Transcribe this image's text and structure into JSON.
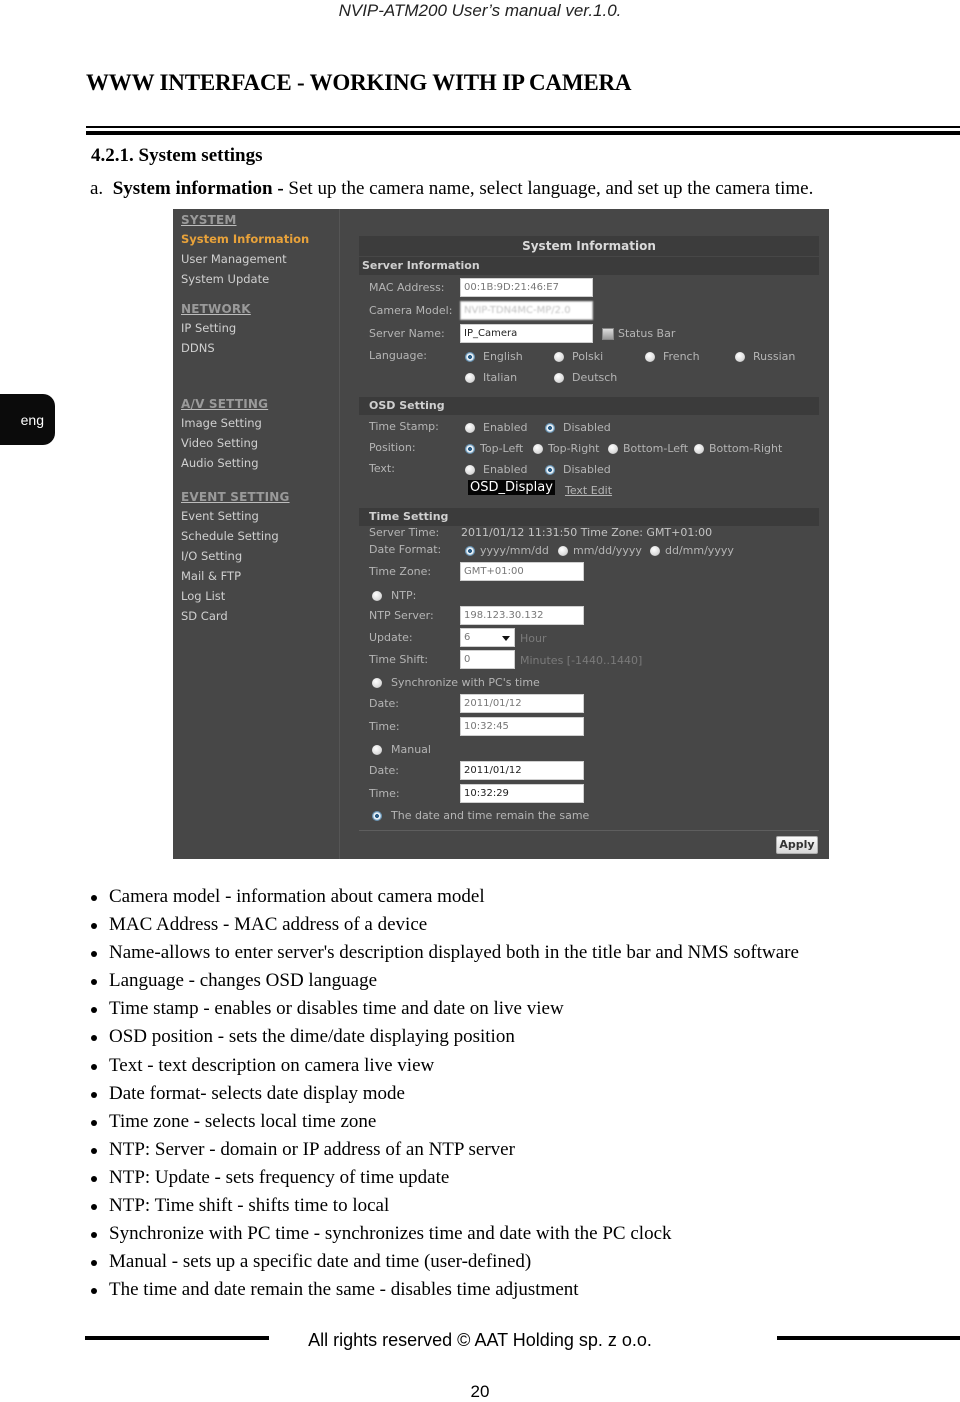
{
  "running_header": "NVIP-ATM200 User’s manual ver.1.0.",
  "chapter_title": "WWW INTERFACE - WORKING WITH IP CAMERA",
  "section_heading": "4.2.1. System settings",
  "intro": {
    "marker": "a.",
    "bold": "System information -",
    "text": " Set up the camera name, select language, and set up the camera time."
  },
  "language_tab": "eng",
  "camera_ui": {
    "sidebar": {
      "groups": [
        {
          "header": "SYSTEM",
          "items": [
            {
              "label": "System Information",
              "active": true
            },
            {
              "label": "User Management"
            },
            {
              "label": "System Update"
            }
          ]
        },
        {
          "header": "NETWORK",
          "items": [
            {
              "label": "IP Setting"
            },
            {
              "label": "DDNS"
            }
          ]
        },
        {
          "header": "A/V SETTING",
          "items": [
            {
              "label": "Image Setting"
            },
            {
              "label": "Video Setting"
            },
            {
              "label": "Audio Setting"
            }
          ]
        },
        {
          "header": "EVENT SETTING",
          "items": [
            {
              "label": "Event Setting"
            },
            {
              "label": "Schedule Setting"
            },
            {
              "label": "I/O Setting"
            },
            {
              "label": "Mail & FTP"
            },
            {
              "label": "Log List"
            },
            {
              "label": "SD Card"
            }
          ]
        }
      ]
    },
    "panel_title": "System Information",
    "server_info": {
      "header": "Server Information",
      "mac_label": "MAC Address:",
      "mac_value": "00:1B:9D:21:46:E7",
      "model_label": "Camera Model:",
      "model_value": "NVIP-TDN4MC-MP/2.0",
      "name_label": "Server Name:",
      "name_value": "IP_Camera",
      "status_bar_label": "Status Bar",
      "status_bar_checked": false,
      "language_label": "Language:",
      "languages": [
        "English",
        "Polski",
        "French",
        "Russian",
        "Italian",
        "Deutsch"
      ],
      "language_selected": "English"
    },
    "osd": {
      "header": "OSD Setting",
      "timestamp_label": "Time Stamp:",
      "timestamp_options": [
        "Enabled",
        "Disabled"
      ],
      "timestamp_selected": "Disabled",
      "position_label": "Position:",
      "position_options": [
        "Top-Left",
        "Top-Right",
        "Bottom-Left",
        "Bottom-Right"
      ],
      "position_selected": "Top-Left",
      "text_label": "Text:",
      "text_options": [
        "Enabled",
        "Disabled"
      ],
      "text_selected": "Disabled",
      "osd_text": "OSD_Display",
      "text_edit_link": "Text Edit"
    },
    "time": {
      "header": "Time Setting",
      "server_time_label": "Server Time:",
      "server_time_value": "2011/01/12 11:31:50 Time Zone: GMT+01:00",
      "date_format_label": "Date Format:",
      "date_formats": [
        "yyyy/mm/dd",
        "mm/dd/yyyy",
        "dd/mm/yyyy"
      ],
      "date_format_selected": "yyyy/mm/dd",
      "timezone_label": "Time Zone:",
      "timezone_value": "GMT+01:00",
      "ntp_label": "NTP:",
      "ntp_server_label": "NTP Server:",
      "ntp_server_value": "198.123.30.132",
      "update_label": "Update:",
      "update_value": "6",
      "update_unit": "Hour",
      "shift_label": "Time Shift:",
      "shift_value": "0",
      "shift_unit": "Minutes  [-1440..1440]",
      "sync_label": "Synchronize with PC's time",
      "sync_date_label": "Date:",
      "sync_date_value": "2011/01/12",
      "sync_time_label": "Time:",
      "sync_time_value": "10:32:45",
      "manual_label": "Manual",
      "manual_date_label": "Date:",
      "manual_date_value": "2011/01/12",
      "manual_time_label": "Time:",
      "manual_time_value": "10:32:29",
      "same_label": "The date and time remain the same",
      "mode_selected": "same"
    },
    "apply_label": "Apply"
  },
  "bullets": [
    "Camera model - information about camera model",
    "MAC Address - MAC address of a device",
    "Name-allows to enter server's description displayed both in the title bar and NMS software",
    "Language - changes OSD language",
    "Time stamp - enables or disables time and date on live view",
    "OSD position - sets the dime/date displaying position",
    "Text - text description on camera live view",
    "Date format- selects date display mode",
    "Time zone - selects local time zone",
    "NTP: Server - domain or IP address of an NTP server",
    "NTP: Update - sets frequency of time update",
    "NTP: Time shift - shifts time to local",
    "Synchronize with PC time - synchronizes time and date with the PC clock",
    "Manual - sets up a specific date and time (user-defined)",
    "The time and date remain the same - disables time adjustment"
  ],
  "footer": "All rights reserved © AAT Holding sp. z o.o.",
  "page_number": "20"
}
